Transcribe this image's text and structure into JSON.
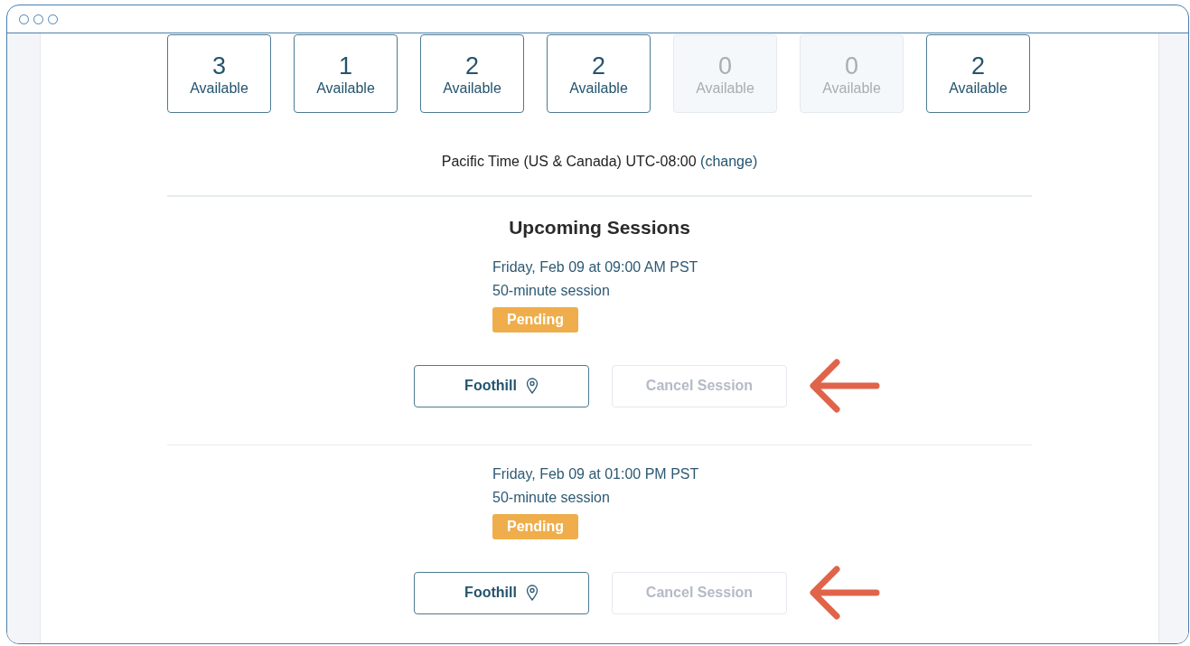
{
  "days": [
    {
      "count": "3",
      "label": "Available",
      "disabled": false
    },
    {
      "count": "1",
      "label": "Available",
      "disabled": false
    },
    {
      "count": "2",
      "label": "Available",
      "disabled": false
    },
    {
      "count": "2",
      "label": "Available",
      "disabled": false
    },
    {
      "count": "0",
      "label": "Available",
      "disabled": true
    },
    {
      "count": "0",
      "label": "Available",
      "disabled": true
    },
    {
      "count": "2",
      "label": "Available",
      "disabled": false
    }
  ],
  "timezone": {
    "text": "Pacific Time (US & Canada) UTC-08:00",
    "link": "(change)"
  },
  "heading": "Upcoming Sessions",
  "sessions": [
    {
      "datetime": "Friday, Feb 09 at 09:00 AM PST",
      "length": "50-minute session",
      "status": "Pending",
      "location": "Foothill",
      "cancel": {
        "label": "Cancel Session",
        "disabled": true
      },
      "arrow": true
    },
    {
      "datetime": "Friday, Feb 09 at 01:00 PM PST",
      "length": "50-minute session",
      "status": "Pending",
      "location": "Foothill",
      "cancel": {
        "label": "Cancel Session",
        "disabled": true
      },
      "arrow": true
    }
  ]
}
